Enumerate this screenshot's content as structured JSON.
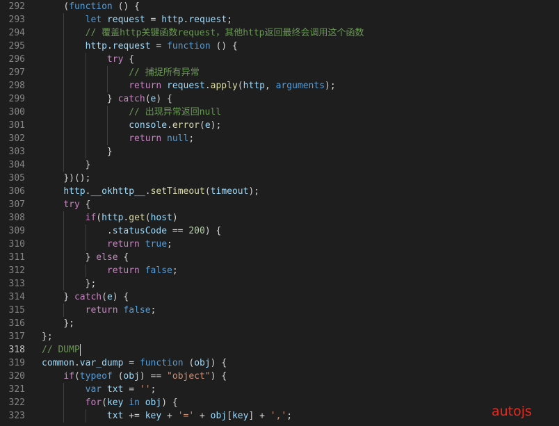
{
  "editor": {
    "watermark": "autojs",
    "active_line": "318",
    "line_numbers": [
      "292",
      "293",
      "294",
      "295",
      "296",
      "297",
      "298",
      "299",
      "300",
      "301",
      "302",
      "303",
      "304",
      "305",
      "306",
      "307",
      "308",
      "309",
      "310",
      "311",
      "312",
      "313",
      "314",
      "315",
      "316",
      "317",
      "318",
      "319",
      "320",
      "321",
      "322",
      "323"
    ],
    "lines": [
      [
        [
          "    ",
          "p"
        ],
        [
          "(",
          "p"
        ],
        [
          "function",
          "kw"
        ],
        [
          " () {",
          "p"
        ]
      ],
      [
        [
          "        ",
          "p"
        ],
        [
          "let",
          "kw"
        ],
        [
          " ",
          "p"
        ],
        [
          "request",
          "v"
        ],
        [
          " = ",
          "p"
        ],
        [
          "http",
          "v"
        ],
        [
          ".",
          "p"
        ],
        [
          "request",
          "v"
        ],
        [
          ";",
          "p"
        ]
      ],
      [
        [
          "        ",
          "p"
        ],
        [
          "// 覆盖http关键函数request，其他http返回最终会调用这个函数",
          "c"
        ]
      ],
      [
        [
          "        ",
          "p"
        ],
        [
          "http",
          "v"
        ],
        [
          ".",
          "p"
        ],
        [
          "request",
          "v"
        ],
        [
          " = ",
          "p"
        ],
        [
          "function",
          "kw"
        ],
        [
          " () {",
          "p"
        ]
      ],
      [
        [
          "            ",
          "p"
        ],
        [
          "try",
          "kwc"
        ],
        [
          " {",
          "p"
        ]
      ],
      [
        [
          "                ",
          "p"
        ],
        [
          "// 捕捉所有异常",
          "c"
        ]
      ],
      [
        [
          "                ",
          "p"
        ],
        [
          "return",
          "kwc"
        ],
        [
          " ",
          "p"
        ],
        [
          "request",
          "v"
        ],
        [
          ".",
          "p"
        ],
        [
          "apply",
          "f"
        ],
        [
          "(",
          "p"
        ],
        [
          "http",
          "v"
        ],
        [
          ", ",
          "p"
        ],
        [
          "arguments",
          "kw"
        ],
        [
          ");",
          "p"
        ]
      ],
      [
        [
          "            ",
          "p"
        ],
        [
          "} ",
          "p"
        ],
        [
          "catch",
          "kwc"
        ],
        [
          "(",
          "p"
        ],
        [
          "e",
          "v"
        ],
        [
          ") {",
          "p"
        ]
      ],
      [
        [
          "                ",
          "p"
        ],
        [
          "// 出现异常返回null",
          "c"
        ]
      ],
      [
        [
          "                ",
          "p"
        ],
        [
          "console",
          "v"
        ],
        [
          ".",
          "p"
        ],
        [
          "error",
          "f"
        ],
        [
          "(",
          "p"
        ],
        [
          "e",
          "v"
        ],
        [
          ");",
          "p"
        ]
      ],
      [
        [
          "                ",
          "p"
        ],
        [
          "return",
          "kwc"
        ],
        [
          " ",
          "p"
        ],
        [
          "null",
          "kw"
        ],
        [
          ";",
          "p"
        ]
      ],
      [
        [
          "            ",
          "p"
        ],
        [
          "}",
          "p"
        ]
      ],
      [
        [
          "        ",
          "p"
        ],
        [
          "}",
          "p"
        ]
      ],
      [
        [
          "    ",
          "p"
        ],
        [
          "})();",
          "p"
        ]
      ],
      [
        [
          "    ",
          "p"
        ],
        [
          "http",
          "v"
        ],
        [
          ".",
          "p"
        ],
        [
          "__okhttp__",
          "v"
        ],
        [
          ".",
          "p"
        ],
        [
          "setTimeout",
          "f"
        ],
        [
          "(",
          "p"
        ],
        [
          "timeout",
          "v"
        ],
        [
          ");",
          "p"
        ]
      ],
      [
        [
          "    ",
          "p"
        ],
        [
          "try",
          "kwc"
        ],
        [
          " {",
          "p"
        ]
      ],
      [
        [
          "        ",
          "p"
        ],
        [
          "if",
          "kwc"
        ],
        [
          "(",
          "p"
        ],
        [
          "http",
          "v"
        ],
        [
          ".",
          "p"
        ],
        [
          "get",
          "f"
        ],
        [
          "(",
          "p"
        ],
        [
          "host",
          "v"
        ],
        [
          ")",
          "p"
        ]
      ],
      [
        [
          "            ",
          "p"
        ],
        [
          ".",
          "p"
        ],
        [
          "statusCode",
          "v"
        ],
        [
          " == ",
          "p"
        ],
        [
          "200",
          "n"
        ],
        [
          ") {",
          "p"
        ]
      ],
      [
        [
          "            ",
          "p"
        ],
        [
          "return",
          "kwc"
        ],
        [
          " ",
          "p"
        ],
        [
          "true",
          "kw"
        ],
        [
          ";",
          "p"
        ]
      ],
      [
        [
          "        ",
          "p"
        ],
        [
          "} ",
          "p"
        ],
        [
          "else",
          "kwc"
        ],
        [
          " {",
          "p"
        ]
      ],
      [
        [
          "            ",
          "p"
        ],
        [
          "return",
          "kwc"
        ],
        [
          " ",
          "p"
        ],
        [
          "false",
          "kw"
        ],
        [
          ";",
          "p"
        ]
      ],
      [
        [
          "        ",
          "p"
        ],
        [
          "};",
          "p"
        ]
      ],
      [
        [
          "    ",
          "p"
        ],
        [
          "} ",
          "p"
        ],
        [
          "catch",
          "kwc"
        ],
        [
          "(",
          "p"
        ],
        [
          "e",
          "v"
        ],
        [
          ") {",
          "p"
        ]
      ],
      [
        [
          "        ",
          "p"
        ],
        [
          "return",
          "kwc"
        ],
        [
          " ",
          "p"
        ],
        [
          "false",
          "kw"
        ],
        [
          ";",
          "p"
        ]
      ],
      [
        [
          "    ",
          "p"
        ],
        [
          "};",
          "p"
        ]
      ],
      [
        [
          "};",
          "p"
        ]
      ],
      [
        [
          "// DUMP",
          "c"
        ]
      ],
      [
        [
          "common",
          "v"
        ],
        [
          ".",
          "p"
        ],
        [
          "var_dump",
          "v"
        ],
        [
          " = ",
          "p"
        ],
        [
          "function",
          "kw"
        ],
        [
          " (",
          "p"
        ],
        [
          "obj",
          "v"
        ],
        [
          ") {",
          "p"
        ]
      ],
      [
        [
          "    ",
          "p"
        ],
        [
          "if",
          "kwc"
        ],
        [
          "(",
          "p"
        ],
        [
          "typeof",
          "kw"
        ],
        [
          " (",
          "p"
        ],
        [
          "obj",
          "v"
        ],
        [
          ") == ",
          "p"
        ],
        [
          "\"object\"",
          "s"
        ],
        [
          ") {",
          "p"
        ]
      ],
      [
        [
          "        ",
          "p"
        ],
        [
          "var",
          "kw"
        ],
        [
          " ",
          "p"
        ],
        [
          "txt",
          "v"
        ],
        [
          " = ",
          "p"
        ],
        [
          "''",
          "s"
        ],
        [
          ";",
          "p"
        ]
      ],
      [
        [
          "        ",
          "p"
        ],
        [
          "for",
          "kwc"
        ],
        [
          "(",
          "p"
        ],
        [
          "key",
          "v"
        ],
        [
          " ",
          "p"
        ],
        [
          "in",
          "kw"
        ],
        [
          " ",
          "p"
        ],
        [
          "obj",
          "v"
        ],
        [
          ") {",
          "p"
        ]
      ],
      [
        [
          "            ",
          "p"
        ],
        [
          "txt",
          "v"
        ],
        [
          " += ",
          "p"
        ],
        [
          "key",
          "v"
        ],
        [
          " + ",
          "p"
        ],
        [
          "'='",
          "s"
        ],
        [
          " + ",
          "p"
        ],
        [
          "obj",
          "v"
        ],
        [
          "[",
          "p"
        ],
        [
          "key",
          "v"
        ],
        [
          "] + ",
          "p"
        ],
        [
          "','",
          "s"
        ],
        [
          ";",
          "p"
        ]
      ]
    ]
  }
}
